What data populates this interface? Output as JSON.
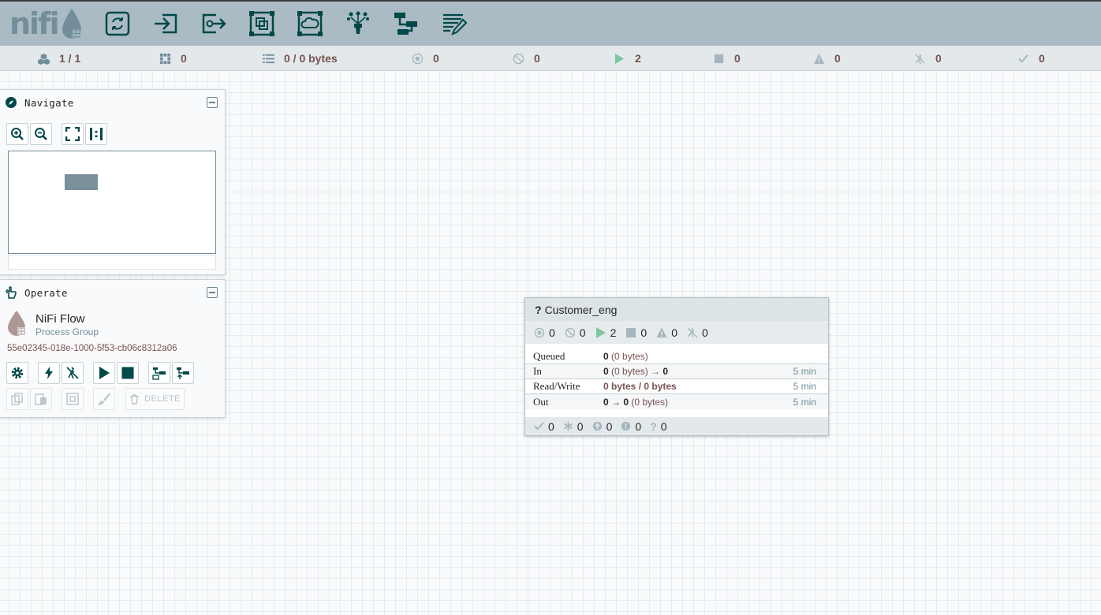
{
  "header": {
    "logo_text": "nifi",
    "toolbar": [
      {
        "name": "processor-icon"
      },
      {
        "name": "input-port-icon"
      },
      {
        "name": "output-port-icon"
      },
      {
        "name": "process-group-icon"
      },
      {
        "name": "remote-process-group-icon"
      },
      {
        "name": "funnel-icon"
      },
      {
        "name": "template-icon"
      },
      {
        "name": "label-icon"
      }
    ]
  },
  "status_bar": {
    "cluster": "1 / 1",
    "active_threads": "0",
    "queued": "0 / 0 bytes",
    "transmitting": "0",
    "not_transmitting": "0",
    "running": "2",
    "stopped": "0",
    "invalid": "0",
    "disabled": "0",
    "up_to_date": "0"
  },
  "navigate": {
    "title": "Navigate"
  },
  "operate": {
    "title": "Operate",
    "name": "NiFi Flow",
    "type": "Process Group",
    "id": "55e02345-018e-1000-5f53-cb06c8312a06",
    "delete_label": "DELETE"
  },
  "process_group": {
    "name": "Customer_eng",
    "stats": {
      "transmitting": "0",
      "not_transmitting": "0",
      "running": "2",
      "stopped": "0",
      "invalid": "0",
      "disabled": "0"
    },
    "rows": {
      "queued_label": "Queued",
      "queued_count": "0",
      "queued_size": " (0 bytes)",
      "in_label": "In",
      "in_count": "0",
      "in_size": " (0 bytes) → ",
      "in_out": "0",
      "in_time": "5 min",
      "rw_label": "Read/Write",
      "rw_value": "0 bytes / 0 bytes",
      "rw_time": "5 min",
      "out_label": "Out",
      "out_count": "0 → 0",
      "out_size": " (0 bytes)",
      "out_time": "5 min"
    },
    "versions": {
      "up_to_date": "0",
      "locally_modified": "0",
      "stale": "0",
      "modified_stale": "0",
      "sync_failure": "0"
    }
  },
  "colors": {
    "header_bg": "#aabbc3",
    "icon_dark": "#004849",
    "status_value": "#775351",
    "running_green": "#7dc7a0"
  }
}
